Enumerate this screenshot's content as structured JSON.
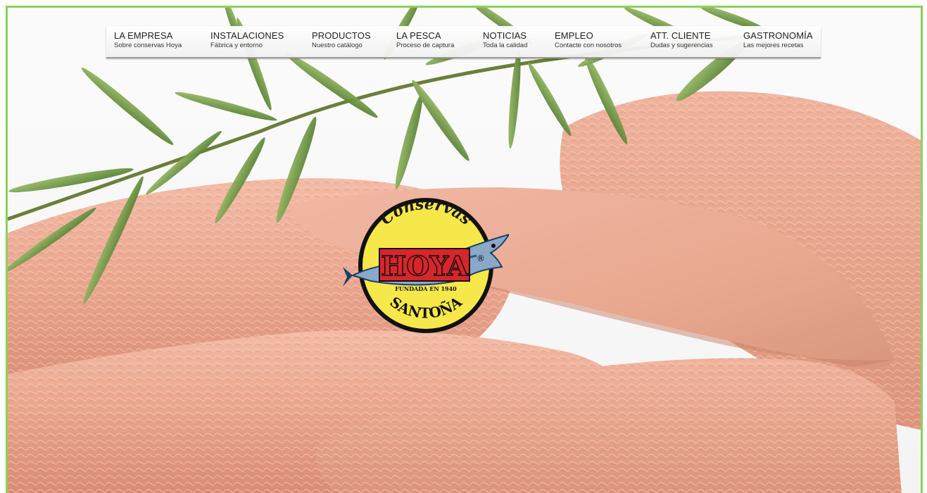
{
  "colors": {
    "frame": "#8cd15a",
    "logo_yellow": "#f6e84a",
    "logo_red": "#d8252a",
    "logo_blue": "#2a5d8f",
    "fish": "#8aa8c8"
  },
  "nav": {
    "items": [
      {
        "title": "LA EMPRESA",
        "subtitle": "Sobre conservas Hoya"
      },
      {
        "title": "INSTALACIONES",
        "subtitle": "Fábrica y entorno"
      },
      {
        "title": "PRODUCTOS",
        "subtitle": "Nuestro catálogo"
      },
      {
        "title": "LA PESCA",
        "subtitle": "Proceso de captura"
      },
      {
        "title": "NOTICIAS",
        "subtitle": "Toda la calidad"
      },
      {
        "title": "EMPLEO",
        "subtitle": "Contacte con nosotros"
      },
      {
        "title": "ATT. CLIENTE",
        "subtitle": "Dudas y sugerencias"
      },
      {
        "title": "GASTRONOMÍA",
        "subtitle": "Las mejores recetas"
      }
    ]
  },
  "logo": {
    "top_text": "Conservas",
    "brand": "HOYA",
    "registered": "®",
    "founded": "FUNDADA EN 1940",
    "bottom_text": "SANTOÑA"
  },
  "hero": {
    "image_icon": "tuna-rosemary-photo"
  }
}
